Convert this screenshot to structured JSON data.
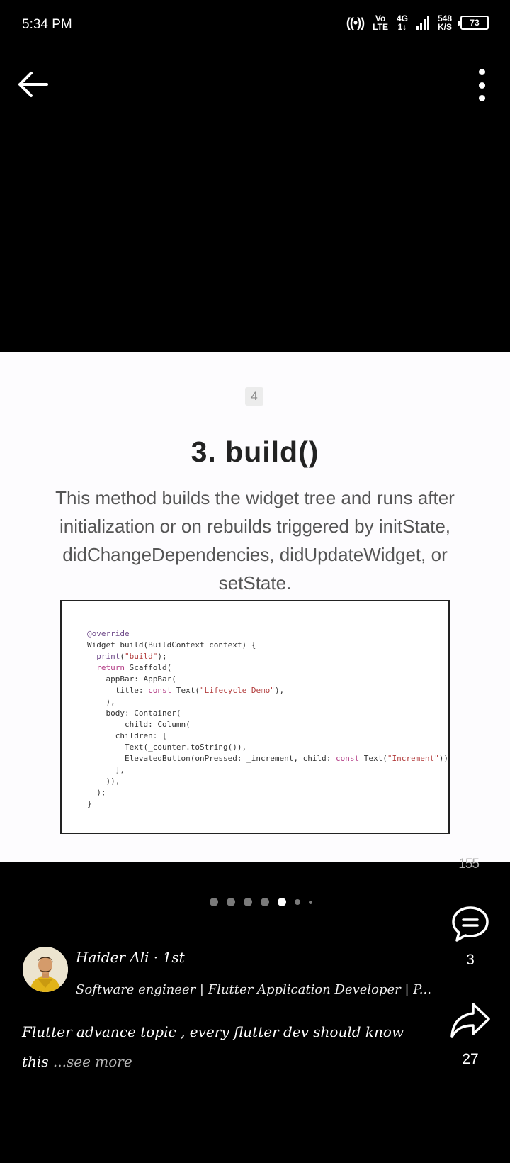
{
  "status_bar": {
    "time": "5:34 PM",
    "network_top": "Vo",
    "network_bottom": "LTE",
    "signal_top": "4G",
    "signal_bottom": "1↓",
    "speed_value": "548",
    "speed_unit": "K/S",
    "battery": "73"
  },
  "slide": {
    "page_number": "4",
    "title": "3. build()",
    "description": "This method builds the widget tree and runs after initialization or on rebuilds triggered by initState, didChangeDependencies, didUpdateWidget, or setState.",
    "code": [
      [
        {
          "t": "@override",
          "c": "ann"
        }
      ],
      [
        {
          "t": "Widget build(BuildContext context) {"
        }
      ],
      [
        {
          "t": "  "
        },
        {
          "t": "print",
          "c": "ann"
        },
        {
          "t": "("
        },
        {
          "t": "\"build\"",
          "c": "str"
        },
        {
          "t": ");"
        }
      ],
      [
        {
          "t": "  "
        },
        {
          "t": "return",
          "c": "kw"
        },
        {
          "t": " Scaffold("
        }
      ],
      [
        {
          "t": "    appBar: AppBar("
        }
      ],
      [
        {
          "t": "      title: "
        },
        {
          "t": "const",
          "c": "kw"
        },
        {
          "t": " Text("
        },
        {
          "t": "\"Lifecycle Demo\"",
          "c": "str"
        },
        {
          "t": "),"
        }
      ],
      [
        {
          "t": "    ),"
        }
      ],
      [
        {
          "t": "    body: Container("
        }
      ],
      [
        {
          "t": "        child: Column("
        }
      ],
      [
        {
          "t": "      children: ["
        }
      ],
      [
        {
          "t": "        Text(_counter.toString()),"
        }
      ],
      [
        {
          "t": "        ElevatedButton(onPressed: _increment, child: "
        },
        {
          "t": "const",
          "c": "kw"
        },
        {
          "t": " Text("
        },
        {
          "t": "\"Increment\"",
          "c": "str"
        },
        {
          "t": "))"
        }
      ],
      [
        {
          "t": "      ],"
        }
      ],
      [
        {
          "t": "    )),"
        }
      ],
      [
        {
          "t": "  );"
        }
      ],
      [
        {
          "t": "}"
        }
      ]
    ]
  },
  "slide_counter": "155",
  "pagination": {
    "total": 7,
    "active_index": 4
  },
  "actions": {
    "comment_count": "3",
    "share_count": "27"
  },
  "author": {
    "name": "Haider Ali · 1st",
    "headline": "Software engineer | Flutter Application Developer | P..."
  },
  "post": {
    "caption": "Flutter advance topic , every flutter dev should know this",
    "see_more": " ...see more"
  },
  "icons": {
    "back": "arrow-left-icon",
    "more": "more-vertical-icon",
    "comment": "comment-bubble-icon",
    "share": "share-arrow-icon",
    "hotspot": "hotspot-icon"
  }
}
